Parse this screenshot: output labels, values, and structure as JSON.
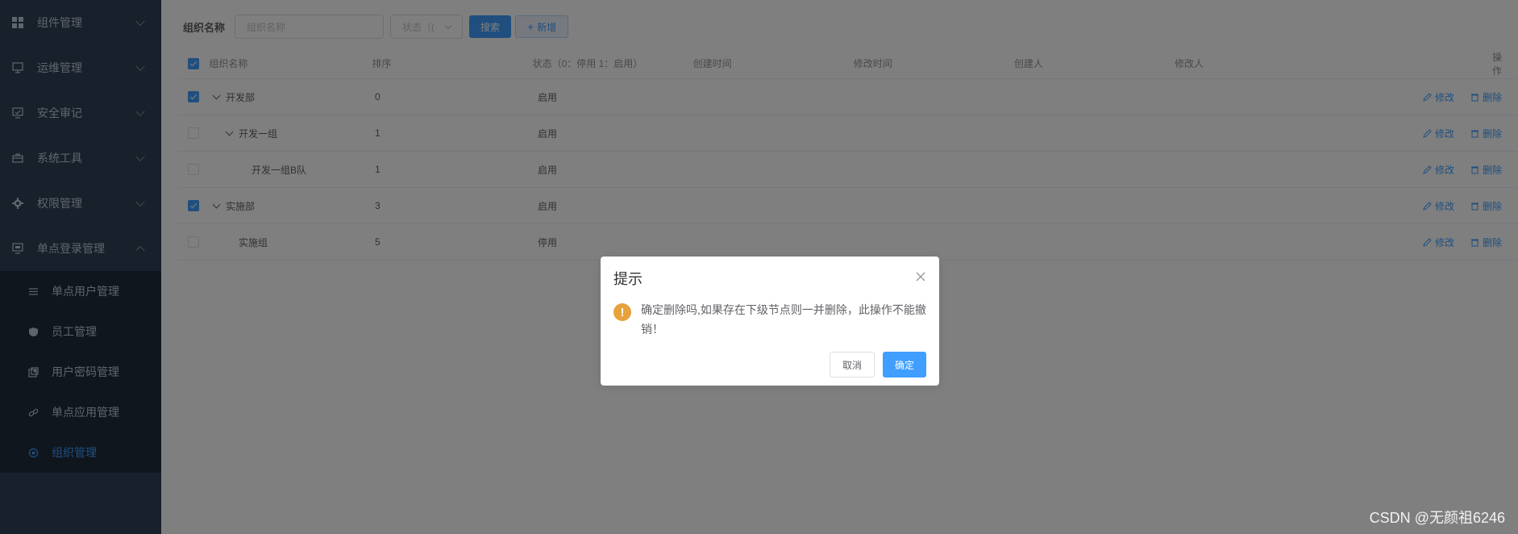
{
  "sidebar": {
    "items": [
      {
        "label": "组件管理",
        "icon": "grid-icon"
      },
      {
        "label": "运维管理",
        "icon": "monitor-icon"
      },
      {
        "label": "安全审记",
        "icon": "screen-check-icon"
      },
      {
        "label": "系统工具",
        "icon": "toolbox-icon"
      },
      {
        "label": "权限管理",
        "icon": "gear-icon"
      },
      {
        "label": "单点登录管理",
        "icon": "desktop-icon"
      }
    ],
    "subitems": [
      {
        "label": "单点用户管理",
        "icon": "user-list-icon"
      },
      {
        "label": "员工管理",
        "icon": "shield-icon"
      },
      {
        "label": "用户密码管理",
        "icon": "key-icon"
      },
      {
        "label": "单点应用管理",
        "icon": "link-icon"
      },
      {
        "label": "组织管理",
        "icon": "org-icon"
      }
    ]
  },
  "search": {
    "label": "组织名称",
    "name_placeholder": "组织名称",
    "status_placeholder": "状态（(",
    "search_button": "搜索",
    "add_button": "新增"
  },
  "table": {
    "headers": {
      "name": "组织名称",
      "sort": "排序",
      "status": "状态（0：停用 1：启用）",
      "create_time": "创建时间",
      "modify_time": "修改时间",
      "creator": "创建人",
      "modifier": "修改人",
      "ops": "操作"
    },
    "rows": [
      {
        "name": "开发部",
        "sort": "0",
        "status": "启用"
      },
      {
        "name": "开发一组",
        "sort": "1",
        "status": "启用"
      },
      {
        "name": "开发一组B队",
        "sort": "1",
        "status": "启用"
      },
      {
        "name": "实施部",
        "sort": "3",
        "status": "启用"
      },
      {
        "name": "实施组",
        "sort": "5",
        "status": "停用"
      }
    ],
    "edit_label": "修改",
    "delete_label": "删除"
  },
  "dialog": {
    "title": "提示",
    "message": "确定删除吗,如果存在下级节点则一并删除，此操作不能撤销！",
    "cancel": "取消",
    "confirm": "确定"
  },
  "watermark": "CSDN @无颜祖6246",
  "colors": {
    "sidebar_bg": "#304156",
    "submenu_bg": "#1f2d3d",
    "primary": "#409eff",
    "warning": "#e6a23c"
  }
}
